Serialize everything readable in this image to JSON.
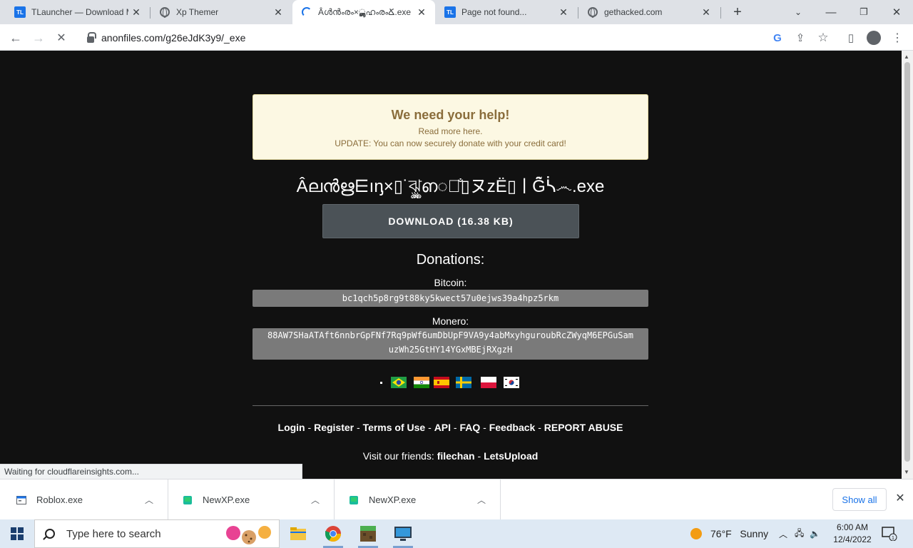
{
  "tabs": [
    {
      "title": "TLauncher — Download M",
      "favicon": "tlauncher-icon",
      "active": false
    },
    {
      "title": "Xp Themer",
      "favicon": "globe-icon",
      "active": false
    },
    {
      "title": "Âൾൻൟ×⁠ൣൢഹ‌ൟՃ.exe",
      "favicon": "loading-spinner-icon",
      "active": true
    },
    {
      "title": "Page not found...",
      "favicon": "tlauncher-icon",
      "active": false
    },
    {
      "title": "gethacked.com",
      "favicon": "globe-icon",
      "active": false
    }
  ],
  "tl_badge": "TL",
  "toolbar": {
    "url": "anonfiles.com/g26eJdK3y9/_exe"
  },
  "page": {
    "help": {
      "heading": "We need your help!",
      "line1": "Read more here.",
      "line2": "UPDATE: You can now securely donate with your credit card!"
    },
    "file_title": "Âലൻഋ⋿ıᶇ×▯˙ঝৢৣഩ៍̐▯ヌzË▯ㅣĜ̃ᓵ෴.exe",
    "download_label": "DOWNLOAD (16.38 KB)",
    "donations_heading": "Donations:",
    "bitcoin_label": "Bitcoin:",
    "bitcoin_address": "bc1qch5p8rg9t88ky5kwect57u0ejws39a4hpz5rkm",
    "monero_label": "Monero:",
    "monero_address_line1": "88AW7SHaATAft6nnbrGpFNf7Rq9pWf6umDbUpF9VA9y4abMxyhguroubRcZWyqM6EPGuSam",
    "monero_address_line2": "uzWh25GtHY14YGxMBEjRXgzH",
    "footer": {
      "login": "Login",
      "register": "Register",
      "terms": "Terms of Use",
      "api": "API",
      "faq": "FAQ",
      "feedback": "Feedback",
      "report": "REPORT ABUSE",
      "separator": " - "
    },
    "friends_prefix": "Visit our friends: ",
    "friend1": "filechan",
    "friend2": "LetsUpload"
  },
  "status_text": "Waiting for cloudflareinsights.com...",
  "downloads": [
    {
      "name": "Roblox.exe"
    },
    {
      "name": "NewXP.exe"
    },
    {
      "name": "NewXP.exe"
    }
  ],
  "show_all": "Show all",
  "taskbar": {
    "search_placeholder": "Type here to search",
    "weather_temp": "76°F",
    "weather_cond": "Sunny",
    "time": "6:00 AM",
    "date": "12/4/2022"
  },
  "colors": {
    "page_bg": "#111111",
    "help_bg": "#fcf8e3",
    "help_text": "#8a6d3b",
    "download_bg": "#4b5257",
    "address_bg": "#7a7a7a",
    "link_blue": "#1a73e8"
  }
}
